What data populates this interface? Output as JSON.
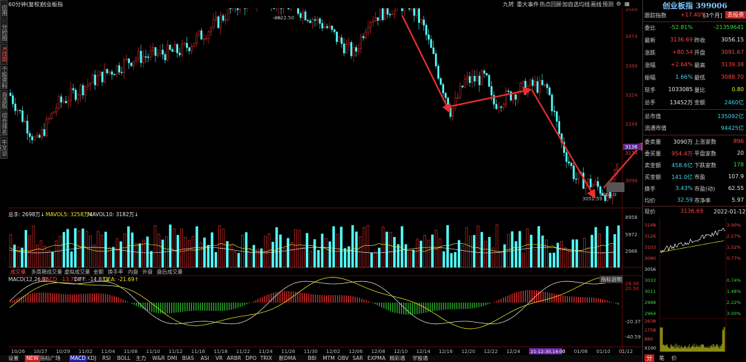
{
  "left_tabs": [
    "应用",
    "分时图",
    "K线图",
    "个股资料",
    "自选股",
    "综合排名",
    "牛叉诊断"
  ],
  "top": {
    "period_label": "60分钟(复权)",
    "index_name": "创业板指",
    "links": [
      "九转",
      "重大事件",
      "热点回顾",
      "加自选",
      "均线",
      "画线",
      "预测"
    ]
  },
  "price_axis": [
    "3549",
    "3474",
    "3399",
    "3324",
    "3249",
    "3174",
    "3099"
  ],
  "price_markers": {
    "high": "3622.50",
    "low_left": "3051.59",
    "last": "3066.0",
    "cur_tag": "3136",
    "cur_tag2": "3174"
  },
  "volume": {
    "legend_total": "总手: 2698万↓",
    "legend_ma5": "MAVOL5: 3258万↓",
    "legend_ma10": "MAVOL10: 3182万↓",
    "axis": [
      "8958",
      "5972",
      "2986"
    ]
  },
  "vol_tabs": [
    "成交量",
    "多周期成交量",
    "虚拟成交量",
    "金额",
    "换手率",
    "内盘",
    "外盘",
    "盘后成交量"
  ],
  "macd": {
    "legend_name": "MACD(12,26,9)",
    "legend_macd": "MACD: -13.71↑",
    "legend_diff": "DIFF: -14.83↓",
    "legend_dea": "DEA: -21.69↑",
    "help": "指标说明",
    "axis": [
      "28.36",
      "20.50",
      "-20.37",
      "-40.59"
    ]
  },
  "date_axis": [
    "10/26",
    "10/27",
    "10/29",
    "11/02",
    "11/04",
    "11/08",
    "11/10",
    "11/12",
    "11/16",
    "11/18",
    "11/22",
    "11/24",
    "11/26",
    "11/30",
    "12/02",
    "12/06",
    "12/08",
    "12/10",
    "12/14",
    "12/16",
    "12/20",
    "12/22",
    "12/24",
    "12/28",
    "12/30",
    "01/06",
    "01/10",
    "01/12"
  ],
  "date_highlight": "21-12-30,14:00",
  "bottom_bar": [
    "设置",
    "NEW",
    "指标广场",
    "MACD",
    "KDJ",
    "RSI",
    "BOLL",
    "主力",
    "W&R",
    "DMI",
    "BIAS",
    "ASI",
    "VR",
    "ARBR",
    "DPO",
    "TRIX",
    "新DMA",
    "BBI",
    "MTM",
    "OBV",
    "SAR",
    "EXPMA",
    "精彩通",
    "学股通"
  ],
  "bottom_active": "MACD",
  "panel": {
    "title": "创业板指 399006",
    "track_label": "跟踪指数",
    "track_val": "+17.40%",
    "track_period": "[3个月]",
    "track_btn": "去投资",
    "rows1": [
      {
        "l": "委比",
        "v": "-52.81%",
        "l2": "",
        "v2": "-21359641",
        "c": "green",
        "c2": "green"
      },
      {
        "l": "最新",
        "v": "3136.69",
        "l2": "昨收",
        "v2": "3056.15",
        "c": "red",
        "c2": "white"
      },
      {
        "l": "涨跌",
        "v": "+80.54",
        "l2": "开盘",
        "v2": "3091.67",
        "c": "red",
        "c2": "red"
      },
      {
        "l": "涨幅",
        "v": "+2.64%",
        "l2": "最高",
        "v2": "3139.38",
        "c": "red",
        "c2": "red"
      },
      {
        "l": "振幅",
        "v": "1.66%",
        "l2": "最低",
        "v2": "3088.70",
        "c": "cyan",
        "c2": "red"
      },
      {
        "l": "现手",
        "v": "1033085",
        "l2": "量比",
        "v2": "0.80",
        "c": "white",
        "c2": "yellow"
      },
      {
        "l": "总手",
        "v": "13452万",
        "l2": "金额",
        "v2": "2460亿",
        "c": "white",
        "c2": "cyan"
      }
    ],
    "rows2": [
      {
        "l": "总市值",
        "v": "135092亿",
        "c": "cyan"
      },
      {
        "l": "流通市值",
        "v": "94425亿",
        "c": "cyan"
      }
    ],
    "rows3": [
      {
        "l": "委卖量",
        "v": "3090万",
        "l2": "上涨家数",
        "v2": "896",
        "c": "white",
        "c2": "red"
      },
      {
        "l": "委买量",
        "v": "954.4万",
        "l2": "平盘家数",
        "v2": "20",
        "c": "red",
        "c2": "white"
      },
      {
        "l": "卖金额",
        "v": "458.6亿",
        "l2": "下跌家数",
        "v2": "178",
        "c": "cyan",
        "c2": "green"
      },
      {
        "l": "买金额",
        "v": "141.0亿",
        "l2": "市盈",
        "v2": "107.9",
        "c": "cyan",
        "c2": "white"
      },
      {
        "l": "换手",
        "v": "3.43%",
        "l2": "市盈(动)",
        "v2": "62.55",
        "c": "cyan",
        "c2": "white"
      },
      {
        "l": "均价",
        "v": "32.59",
        "l2": "市净率",
        "v2": "5.97",
        "c": "cyan",
        "c2": "white"
      }
    ],
    "mini": {
      "label": "现价",
      "price": "3136.69",
      "date": "2022-01-12,三",
      "left_axis": [
        "3148",
        "3126",
        "3103",
        "3080",
        "3056",
        "3033",
        "3011",
        "2988",
        "2964"
      ],
      "right_axis": [
        "3.00%",
        "2.27%",
        "1.52%",
        "0.77%",
        "",
        "0.74%",
        "1.48%",
        "2.22%",
        "3.00%"
      ],
      "vol_axis": [
        "2638",
        "1758",
        "880",
        "X100"
      ]
    },
    "bottom_btns": [
      "分",
      "笔",
      "价"
    ]
  }
}
